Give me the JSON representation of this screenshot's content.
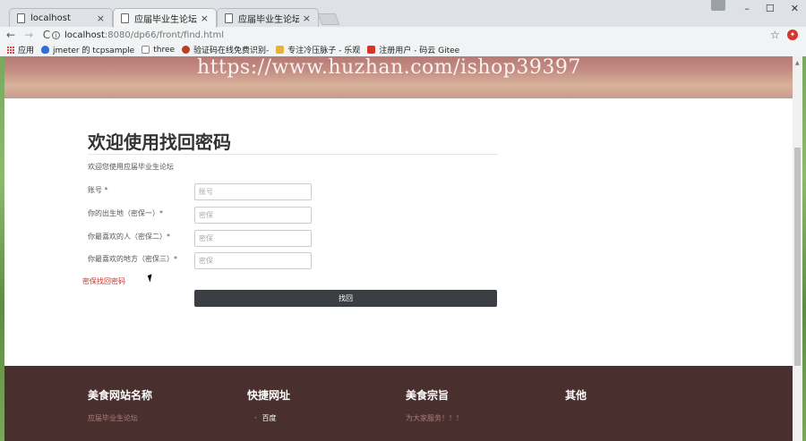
{
  "browser": {
    "tabs": [
      {
        "label": "localhost",
        "close": "×"
      },
      {
        "label": "应届毕业生论坛",
        "close": "×"
      },
      {
        "label": "应届毕业生论坛",
        "close": "×"
      }
    ],
    "window_controls": [
      "–",
      "☐",
      "✕"
    ],
    "url_host": "localhost",
    "url_path": ":8080/dp66/front/find.html",
    "nav": {
      "back": "←",
      "forward": "→",
      "reload": "C"
    },
    "bookmarks": [
      {
        "label": "应用",
        "icon": "apps-icon"
      },
      {
        "label": "jmeter 的 tcpsample",
        "icon": "shield-icon",
        "color": "#2f6fd6"
      },
      {
        "label": "three",
        "icon": "page-icon",
        "color": "#888888"
      },
      {
        "label": "验证码在线免费识别-",
        "icon": "app-icon",
        "color": "#c0392b"
      },
      {
        "label": "专注冷压脉子 - 乐观",
        "icon": "handshake-icon",
        "color": "#e8b33a"
      },
      {
        "label": "注册用户 - 码云 Gitee",
        "icon": "gitee-icon",
        "color": "#d9342b"
      }
    ]
  },
  "banner": {
    "watermark": "https://www.huzhan.com/ishop39397"
  },
  "main": {
    "title": "欢迎使用找回密码",
    "subtitle": "欢迎您使用应届毕业生论坛",
    "fields": [
      {
        "label": "账号 *",
        "placeholder": "账号"
      },
      {
        "label": "你的出生地（密保一）*",
        "placeholder": "密保"
      },
      {
        "label": "你最喜欢的人（密保二）*",
        "placeholder": "密保"
      },
      {
        "label": "你最喜欢的地方（密保三）*",
        "placeholder": "密保"
      }
    ],
    "recover_link": "密保找回密码",
    "submit_label": "找回"
  },
  "footer": {
    "columns": [
      {
        "heading": "美食网站名称",
        "text": "应届毕业生论坛"
      },
      {
        "heading": "快捷网址",
        "link": "百度"
      },
      {
        "heading": "美食宗旨",
        "text": "为大家服务！！！"
      },
      {
        "heading": "其他"
      }
    ]
  },
  "colors": {
    "footer_bg": "#4a2f2f",
    "button_bg": "#3b3e42",
    "link_red": "#c9302c"
  }
}
